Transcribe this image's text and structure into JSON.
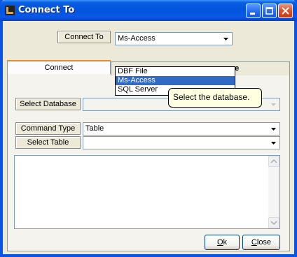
{
  "window": {
    "title": "Connect To"
  },
  "connect_to": {
    "label": "Connect To",
    "selected": "Ms-Access",
    "options": [
      "DBF File",
      "Ms-Access",
      "SQL Server"
    ],
    "selected_index": 1
  },
  "tooltip": "Select the database.",
  "tabs": [
    {
      "label": "Connect"
    },
    {
      "label": "se"
    }
  ],
  "select_database": {
    "label": "Select Database",
    "value": ""
  },
  "command_type": {
    "label": "Command Type",
    "value": "Table"
  },
  "select_table": {
    "label": "Select Table",
    "value": ""
  },
  "buttons": {
    "ok_mnemonic": "O",
    "ok_rest": "k",
    "close_mnemonic": "C",
    "close_rest": "lose"
  },
  "colors": {
    "title_blue": "#0254dd",
    "selection": "#316ac5",
    "tooltip_bg": "#ffffe1"
  }
}
